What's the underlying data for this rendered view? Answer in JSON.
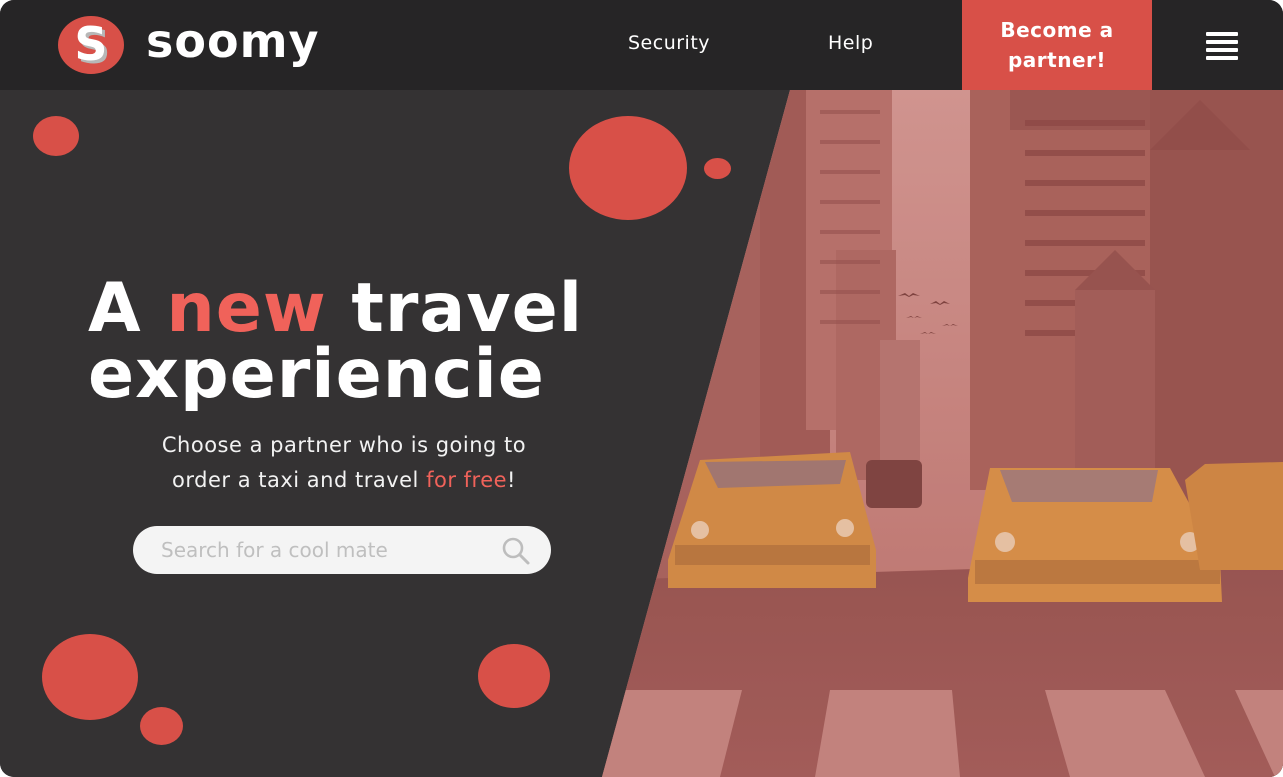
{
  "header": {
    "brand_initial": "S",
    "brand_name": "soomy",
    "nav": {
      "security": "Security",
      "help": "Help"
    },
    "cta_line1": "Become a",
    "cta_line2": "partner!",
    "menu_icon": "hamburger-menu-icon"
  },
  "hero": {
    "headline_part1": "A ",
    "headline_accent": "new",
    "headline_part2": " travel",
    "headline_line2": "experiencie",
    "sub_line1": "Choose a partner who is going to",
    "sub_line2_start": "order a taxi and travel ",
    "sub_line2_accent": "for free",
    "sub_line2_end": "!"
  },
  "search": {
    "placeholder": "Search for a cool mate",
    "icon": "search-icon"
  },
  "colors": {
    "accent": "#d85048",
    "accent_text": "#f0625a",
    "header_bg": "#262526",
    "panel_bg": "#343233",
    "photo_tint": "#b36560"
  }
}
